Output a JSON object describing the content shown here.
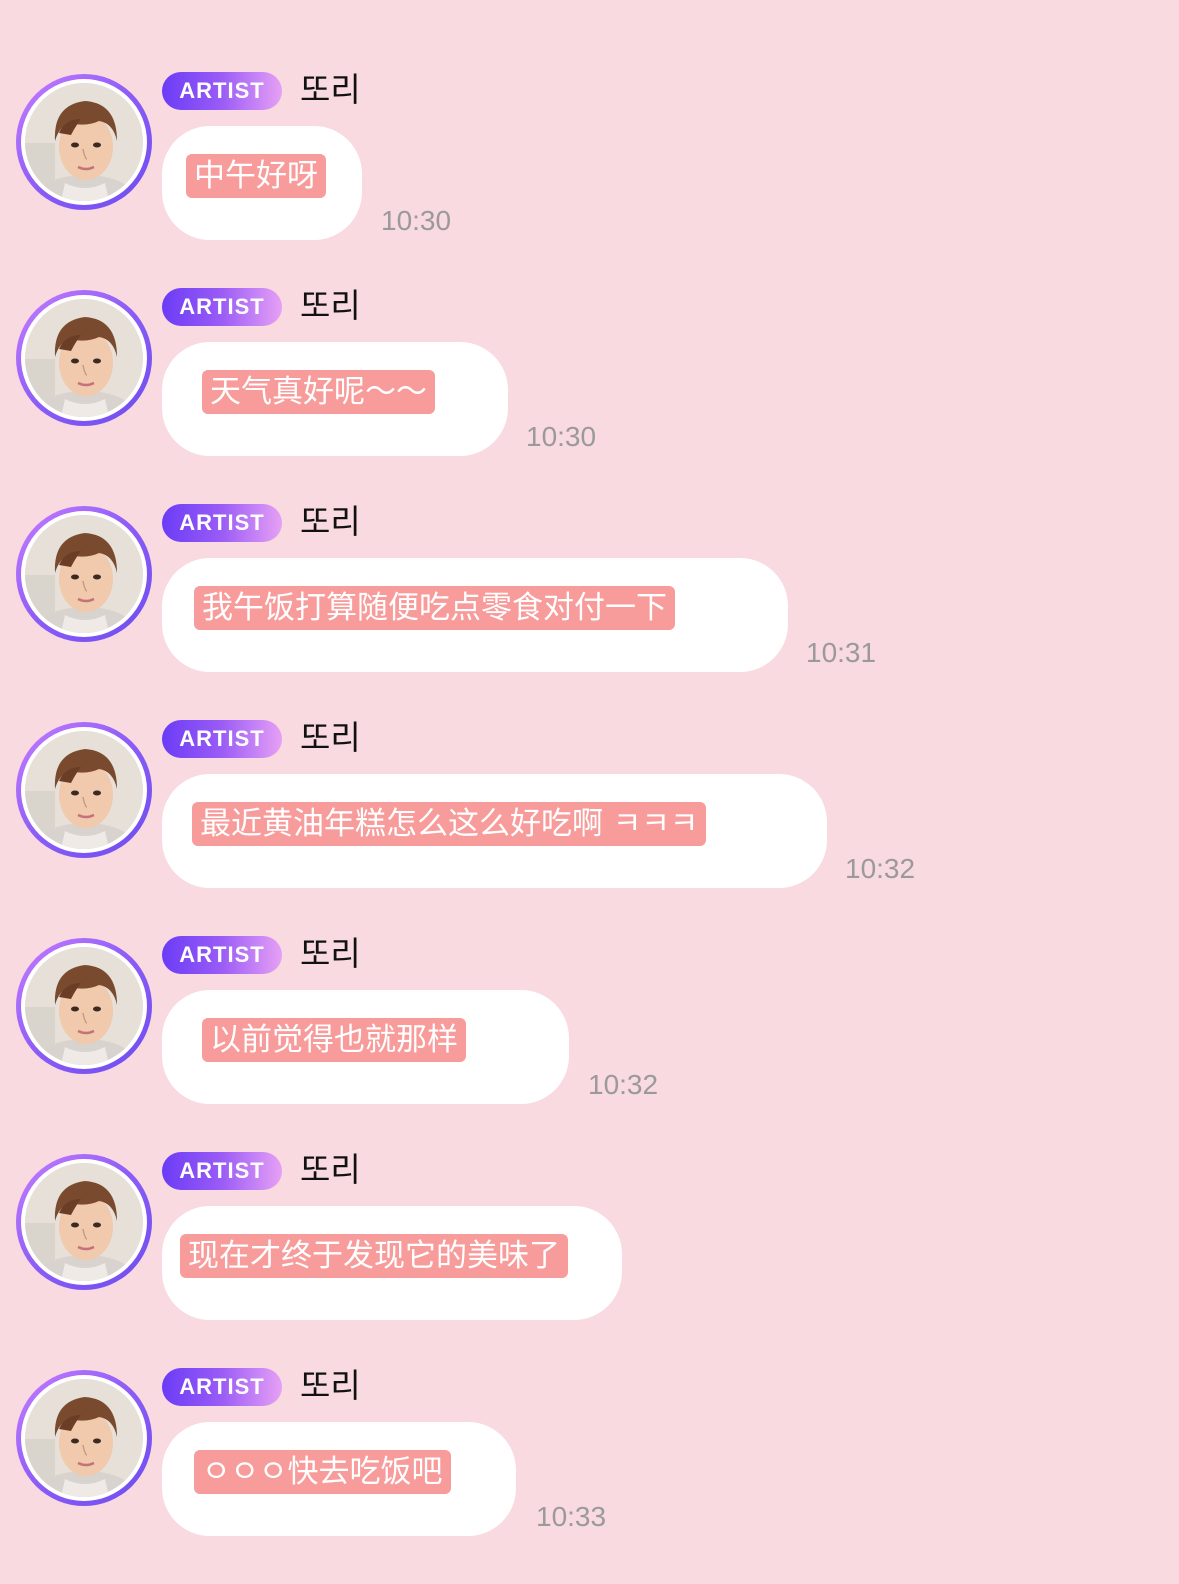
{
  "chat": {
    "background_color": "#f9dae0",
    "sender": {
      "badge": "ARTIST",
      "name": "또리",
      "avatar_icon": "profile-photo"
    },
    "messages": [
      {
        "text": "中午好呀",
        "time": "10:30"
      },
      {
        "text": "天气真好呢～～",
        "time": "10:30"
      },
      {
        "text": "我午饭打算随便吃点零食对付一下",
        "time": "10:31"
      },
      {
        "text": "最近黄油年糕怎么这么好吃啊 ㅋㅋㅋ",
        "time": "10:32"
      },
      {
        "text": "以前觉得也就那样",
        "time": "10:32"
      },
      {
        "text": "现在才终于发现它的美味了",
        "time": ""
      },
      {
        "text": "ㅇㅇㅇ快去吃饭吧",
        "time": "10:33"
      }
    ]
  }
}
